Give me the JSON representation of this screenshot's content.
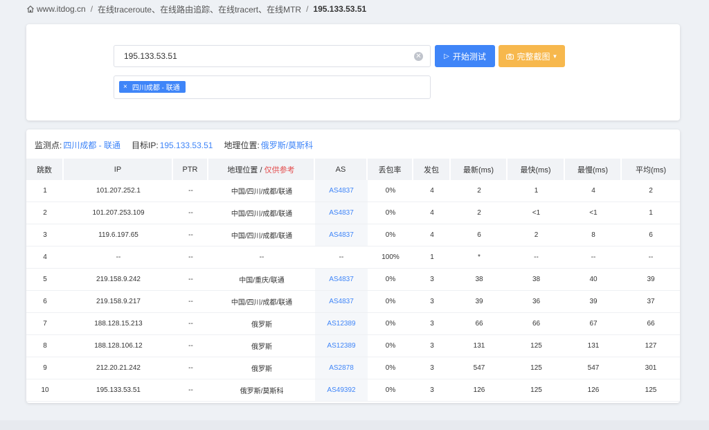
{
  "breadcrumb": {
    "home": "www.itdog.cn",
    "section": "在线traceroute、在线路由追踪、在线tracert、在线MTR",
    "current": "195.133.53.51"
  },
  "search": {
    "ip_value": "195.133.53.51",
    "start_label": "开始测试",
    "screenshot_label": "完整截图",
    "node_tag": "四川成都 - 联通"
  },
  "info": {
    "monitor_label": "监测点:",
    "monitor_value": "四川成都 - 联通",
    "target_label": "目标IP:",
    "target_value": "195.133.53.51",
    "geo_label": "地理位置:",
    "geo_value": "俄罗斯/莫斯科"
  },
  "table": {
    "headers": {
      "hop": "跳数",
      "ip": "IP",
      "ptr": "PTR",
      "geo": "地理位置 / ",
      "geo_note": "仅供参考",
      "as": "AS",
      "loss": "丢包率",
      "sent": "发包",
      "last": "最新(ms)",
      "best": "最快(ms)",
      "worst": "最慢(ms)",
      "avg": "平均(ms)"
    },
    "rows": [
      {
        "hop": "1",
        "ip": "101.207.252.1",
        "ptr": "--",
        "geo": "中国/四川/成都/联通",
        "as": "AS4837",
        "loss": "0%",
        "sent": "4",
        "last": "2",
        "best": "1",
        "worst": "4",
        "avg": "2"
      },
      {
        "hop": "2",
        "ip": "101.207.253.109",
        "ptr": "--",
        "geo": "中国/四川/成都/联通",
        "as": "AS4837",
        "loss": "0%",
        "sent": "4",
        "last": "2",
        "best": "<1",
        "worst": "<1",
        "avg": "1"
      },
      {
        "hop": "3",
        "ip": "119.6.197.65",
        "ptr": "--",
        "geo": "中国/四川/成都/联通",
        "as": "AS4837",
        "loss": "0%",
        "sent": "4",
        "last": "6",
        "best": "2",
        "worst": "8",
        "avg": "6"
      },
      {
        "hop": "4",
        "ip": "--",
        "ptr": "--",
        "geo": "--",
        "as": "--",
        "loss": "100%",
        "sent": "1",
        "last": "*",
        "best": "--",
        "worst": "--",
        "avg": "--"
      },
      {
        "hop": "5",
        "ip": "219.158.9.242",
        "ptr": "--",
        "geo": "中国/重庆/联通",
        "as": "AS4837",
        "loss": "0%",
        "sent": "3",
        "last": "38",
        "best": "38",
        "worst": "40",
        "avg": "39"
      },
      {
        "hop": "6",
        "ip": "219.158.9.217",
        "ptr": "--",
        "geo": "中国/四川/成都/联通",
        "as": "AS4837",
        "loss": "0%",
        "sent": "3",
        "last": "39",
        "best": "36",
        "worst": "39",
        "avg": "37"
      },
      {
        "hop": "7",
        "ip": "188.128.15.213",
        "ptr": "--",
        "geo": "俄罗斯",
        "as": "AS12389",
        "loss": "0%",
        "sent": "3",
        "last": "66",
        "best": "66",
        "worst": "67",
        "avg": "66"
      },
      {
        "hop": "8",
        "ip": "188.128.106.12",
        "ptr": "--",
        "geo": "俄罗斯",
        "as": "AS12389",
        "loss": "0%",
        "sent": "3",
        "last": "131",
        "best": "125",
        "worst": "131",
        "avg": "127"
      },
      {
        "hop": "9",
        "ip": "212.20.21.242",
        "ptr": "--",
        "geo": "俄罗斯",
        "as": "AS2878",
        "loss": "0%",
        "sent": "3",
        "last": "547",
        "best": "125",
        "worst": "547",
        "avg": "301"
      },
      {
        "hop": "10",
        "ip": "195.133.53.51",
        "ptr": "--",
        "geo": "俄罗斯/莫斯科",
        "as": "AS49392",
        "loss": "0%",
        "sent": "3",
        "last": "126",
        "best": "125",
        "worst": "126",
        "avg": "125"
      }
    ]
  },
  "colors": {
    "accent": "#3f85f8",
    "warning": "#f7b84d",
    "note": "#e34d4d"
  }
}
